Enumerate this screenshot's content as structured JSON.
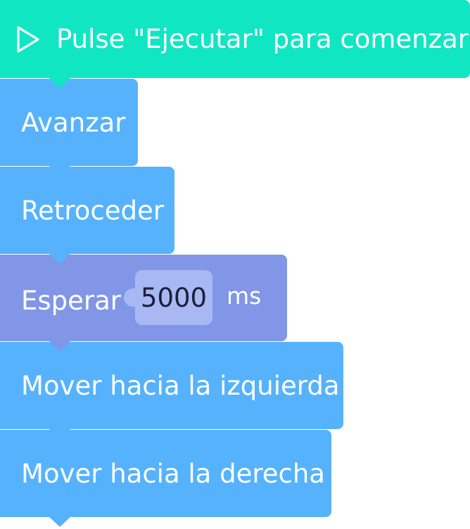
{
  "start_block": {
    "icon": "play-icon",
    "label": "Pulse \"Ejecutar\" para comenzar",
    "color": "#11e6c3"
  },
  "blocks": [
    {
      "label": "Avanzar",
      "color": "#56b2fc"
    },
    {
      "label": "Retroceder",
      "color": "#56b2fc"
    },
    {
      "label": "Esperar",
      "value": "5000",
      "unit": "ms",
      "color": "#8196e6"
    },
    {
      "label": "Mover hacia la izquierda",
      "color": "#56b2fc"
    },
    {
      "label": "Mover hacia la derecha",
      "color": "#56b2fc"
    }
  ]
}
